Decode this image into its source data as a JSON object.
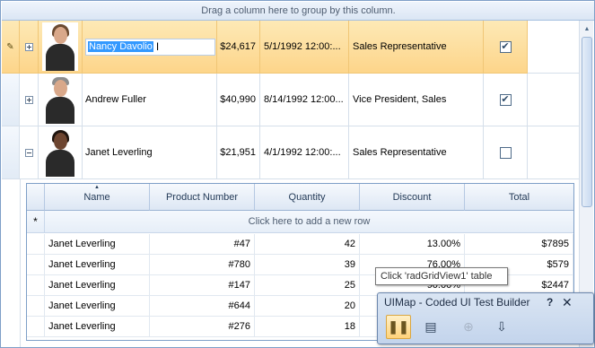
{
  "group_panel": {
    "text": "Drag a column here to group by this column."
  },
  "master_rows": [
    {
      "name": "Nancy Davolio",
      "salary": "$24,617",
      "date": "5/1/1992 12:00:...",
      "title": "Sales Representative",
      "checked": true,
      "expander": "plus",
      "current": true
    },
    {
      "name": "Andrew Fuller",
      "salary": "$40,990",
      "date": "8/14/1992 12:00...",
      "title": "Vice President, Sales",
      "checked": true,
      "expander": "plus"
    },
    {
      "name": "Janet Leverling",
      "salary": "$21,951",
      "date": "4/1/1992 12:00:...",
      "title": "Sales Representative",
      "checked": false,
      "expander": "minus"
    }
  ],
  "child_grid": {
    "headers": [
      "Name",
      "Product Number",
      "Quantity",
      "Discount",
      "Total"
    ],
    "new_row_indicator": "*",
    "new_row_text": "Click here to add a new row",
    "rows": [
      [
        "Janet Leverling",
        "#47",
        "42",
        "13.00%",
        "$7895"
      ],
      [
        "Janet Leverling",
        "#780",
        "39",
        "76.00%",
        "$579"
      ],
      [
        "Janet Leverling",
        "#147",
        "25",
        "90.00%",
        "$2447"
      ],
      [
        "Janet Leverling",
        "#644",
        "20",
        "",
        ""
      ],
      [
        "Janet Leverling",
        "#276",
        "18",
        "",
        ""
      ]
    ]
  },
  "tooltip": {
    "text": "Click 'radGridView1' table"
  },
  "uimap": {
    "title": "UIMap - Coded UI Test Builder",
    "help": "?",
    "close": "✕"
  },
  "icons": {
    "edit_indicator": "pencil-icon",
    "pause": "pause-icon",
    "generate": "generate-code-icon",
    "crosshair": "crosshair-icon",
    "record": "record-steps-icon"
  }
}
